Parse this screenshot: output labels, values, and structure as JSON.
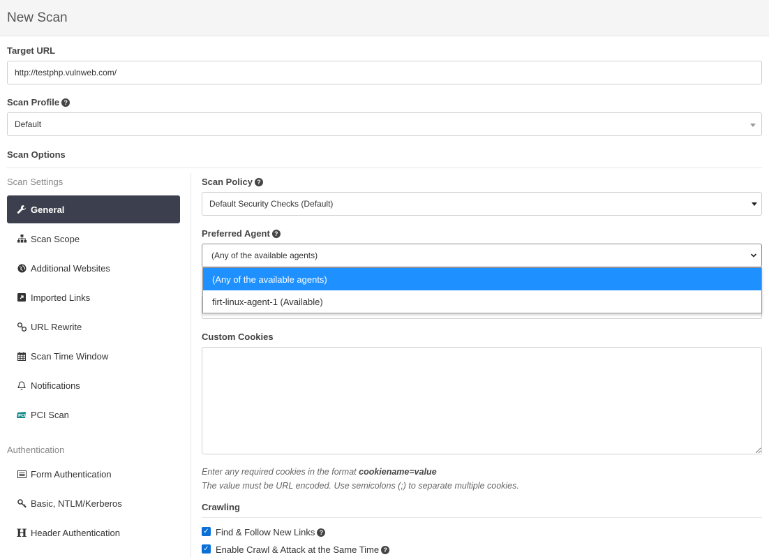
{
  "header": {
    "title": "New Scan"
  },
  "target": {
    "label": "Target URL",
    "value": "http://testphp.vulnweb.com/"
  },
  "profile": {
    "label": "Scan Profile",
    "value": "Default"
  },
  "scan_options_label": "Scan Options",
  "sidebar": {
    "settings_heading": "Scan Settings",
    "items": [
      {
        "label": "General",
        "icon": "wrench-icon",
        "active": true
      },
      {
        "label": "Scan Scope",
        "icon": "sitemap-icon"
      },
      {
        "label": "Additional Websites",
        "icon": "globe-icon"
      },
      {
        "label": "Imported Links",
        "icon": "external-link-icon"
      },
      {
        "label": "URL Rewrite",
        "icon": "link-icon"
      },
      {
        "label": "Scan Time Window",
        "icon": "calendar-icon"
      },
      {
        "label": "Notifications",
        "icon": "bell-icon"
      },
      {
        "label": "PCI Scan",
        "icon": "pci-icon"
      }
    ],
    "auth_heading": "Authentication",
    "auth_items": [
      {
        "label": "Form Authentication",
        "icon": "form-icon"
      },
      {
        "label": "Basic, NTLM/Kerberos",
        "icon": "key-icon"
      },
      {
        "label": "Header Authentication",
        "icon": "header-h-icon"
      }
    ]
  },
  "policy": {
    "label": "Scan Policy",
    "value": "Default Security Checks (Default)"
  },
  "agent": {
    "label": "Preferred Agent",
    "value": "(Any of the available agents)",
    "options": [
      "(Any of the available agents)",
      "firt-linux-agent-1 (Available)"
    ]
  },
  "cookies": {
    "label": "Custom Cookies",
    "value": "",
    "help_prefix": "Enter any required cookies in the format ",
    "help_bold": "cookiename=value",
    "help_line2": "The value must be URL encoded. Use semicolons (;) to separate multiple cookies."
  },
  "crawling": {
    "label": "Crawling",
    "options": [
      {
        "label": "Find & Follow New Links",
        "checked": true
      },
      {
        "label": "Enable Crawl & Attack at the Same Time",
        "checked": true
      }
    ]
  }
}
